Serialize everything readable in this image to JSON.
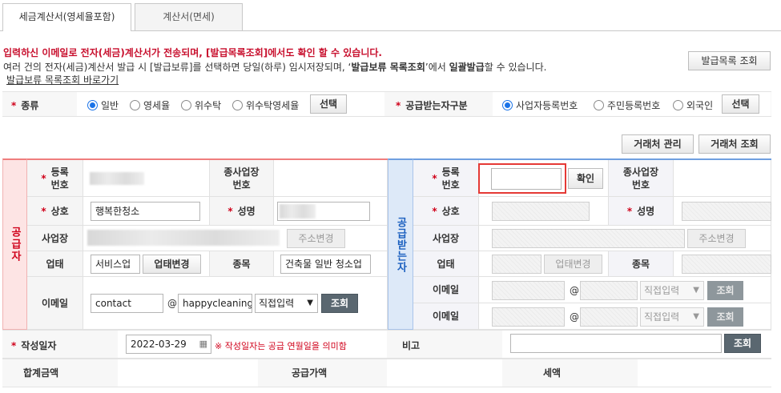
{
  "tabs": [
    {
      "label": "세금계산서(영세율포함)"
    },
    {
      "label": "계산서(면세)"
    }
  ],
  "notices": {
    "line1": "입력하신 이메일로 전자(세금)계산서가 전송되며, [발급목록조회]에서도 확인 할 수 있습니다.",
    "line2_a": "여러 건의 전자(세금)계산서 발급 시 [발급보류]를 선택하면 당일(하루) 임시저장되며, ‘",
    "line2_b": "발급보류 목록조회",
    "line2_c": "’에서 ",
    "line2_d": "일괄발급",
    "line2_e": "할 수 있습니다.",
    "link": "발급보류 목록조회 바로가기"
  },
  "buttons": {
    "issue_list": "발급목록 조회",
    "select": "선택",
    "partner_manage": "거래처 관리",
    "partner_search": "거래처 조회",
    "confirm": "확인",
    "addr_change": "주소변경",
    "biz_change": "업태변경",
    "search": "조회"
  },
  "kind": {
    "label": "종류",
    "options": [
      "일반",
      "영세율",
      "위수탁",
      "위수탁영세율"
    ],
    "selected": "일반"
  },
  "recv_type": {
    "label": "공급받는자구분",
    "options": [
      "사업자등록번호",
      "주민등록번호",
      "외국인"
    ],
    "selected": "사업자등록번호"
  },
  "supplier": {
    "side_label": "공급자",
    "reg_no_label": "등록\n번호",
    "sub_label": "종사업장\n번호",
    "name_label": "상호",
    "name_value": "행복한청소",
    "rep_label": "성명",
    "addr_label": "사업장",
    "type_label": "업태",
    "type_value": "서비스업",
    "item_label": "종목",
    "item_value": "건축물 일반 청소업",
    "email_label": "이메일",
    "email_user": "contact",
    "email_domain": "happycleaning",
    "email_select": "직접입력"
  },
  "receiver": {
    "side_label": "공급받는자",
    "reg_no_label": "등록\n번호",
    "sub_label": "종사업장\n번호",
    "name_label": "상호",
    "rep_label": "성명",
    "addr_label": "사업장",
    "type_label": "업태",
    "item_label": "종목",
    "email_label": "이메일",
    "email_select": "직접입력"
  },
  "bottom": {
    "date_label": "작성일자",
    "date_value": "2022-03-29",
    "date_note": "※ 작성일자는 공급 연월일을 의미함",
    "remark_label": "비고",
    "total_label": "합계금액",
    "supply_label": "공급가액",
    "tax_label": "세액"
  },
  "colors": {
    "accent_red": "#d0021b",
    "supplier_bg": "#fde4e4",
    "receiver_bg": "#dde9f8",
    "highlight": "#e53935"
  }
}
